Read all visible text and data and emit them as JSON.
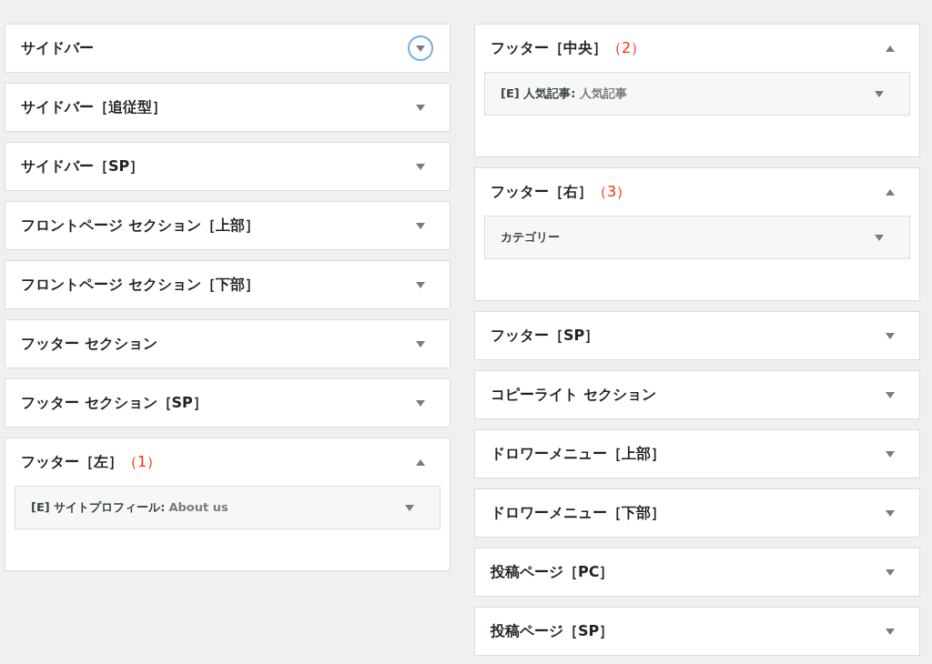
{
  "columns": [
    {
      "panels": [
        {
          "title": "サイドバー",
          "expanded": false,
          "focused": true
        },
        {
          "title": "サイドバー［追従型］",
          "expanded": false,
          "focused": false
        },
        {
          "title": "サイドバー［SP］",
          "expanded": false,
          "focused": false
        },
        {
          "title": "フロントページ セクション［上部］",
          "expanded": false,
          "focused": false
        },
        {
          "title": "フロントページ セクション［下部］",
          "expanded": false,
          "focused": false
        },
        {
          "title": "フッター セクション",
          "expanded": false,
          "focused": false
        },
        {
          "title": "フッター セクション［SP］",
          "expanded": false,
          "focused": false
        },
        {
          "title": "フッター［左］",
          "number": "（1）",
          "expanded": true,
          "focused": false,
          "widgets": [
            {
              "title": "[E] サイトプロフィール:",
              "subtitle": "About us"
            }
          ]
        }
      ]
    },
    {
      "panels": [
        {
          "title": "フッター［中央］",
          "number": "（2）",
          "expanded": true,
          "focused": false,
          "widgets": [
            {
              "title": "[E] 人気記事:",
              "subtitle": "人気記事"
            }
          ]
        },
        {
          "title": "フッター［右］",
          "number": "（3）",
          "expanded": true,
          "focused": false,
          "widgets": [
            {
              "title": "カテゴリー"
            }
          ]
        },
        {
          "title": "フッター［SP］",
          "expanded": false,
          "focused": false
        },
        {
          "title": "コピーライト セクション",
          "expanded": false,
          "focused": false
        },
        {
          "title": "ドロワーメニュー［上部］",
          "expanded": false,
          "focused": false
        },
        {
          "title": "ドロワーメニュー［下部］",
          "expanded": false,
          "focused": false
        },
        {
          "title": "投稿ページ［PC］",
          "expanded": false,
          "focused": false
        },
        {
          "title": "投稿ページ［SP］",
          "expanded": false,
          "focused": false
        }
      ]
    }
  ]
}
